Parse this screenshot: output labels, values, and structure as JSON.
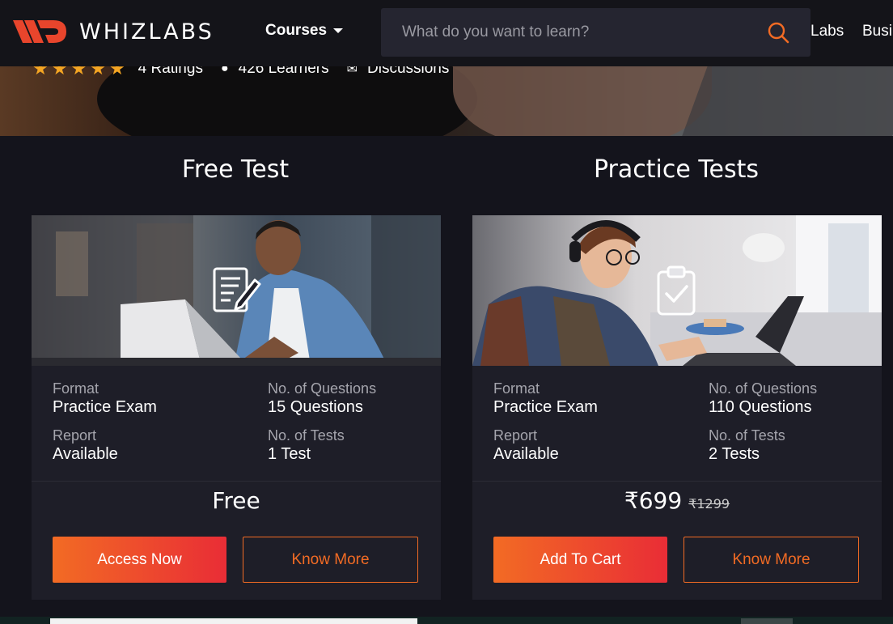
{
  "navbar": {
    "logo_text": "WHIZLABS",
    "courses_label": "Courses",
    "search_placeholder": "What do you want to learn?",
    "links": [
      "Labs",
      "Busi"
    ]
  },
  "hero": {
    "ratings": "4 Ratings",
    "learners": "426 Learners",
    "discussions": "Discussions",
    "stars": 5
  },
  "free_section": {
    "title": "Free Test",
    "format_label": "Format",
    "format_value": "Practice Exam",
    "questions_label": "No. of Questions",
    "questions_value": "15 Questions",
    "report_label": "Report",
    "report_value": "Available",
    "tests_label": "No. of Tests",
    "tests_value": "1 Test",
    "price": "Free",
    "primary_button": "Access Now",
    "secondary_button": "Know More"
  },
  "practice_section": {
    "title": "Practice Tests",
    "format_label": "Format",
    "format_value": "Practice Exam",
    "questions_label": "No. of Questions",
    "questions_value": "110 Questions",
    "report_label": "Report",
    "report_value": "Available",
    "tests_label": "No. of Tests",
    "tests_value": "2 Tests",
    "price": "₹699",
    "old_price": "₹1299",
    "primary_button": "Add To Cart",
    "secondary_button": "Know More"
  },
  "colors": {
    "accent": "#f26b24",
    "accent_end": "#e92d36",
    "background": "#14141c",
    "card": "#1e1e28",
    "star": "#f5a623"
  }
}
